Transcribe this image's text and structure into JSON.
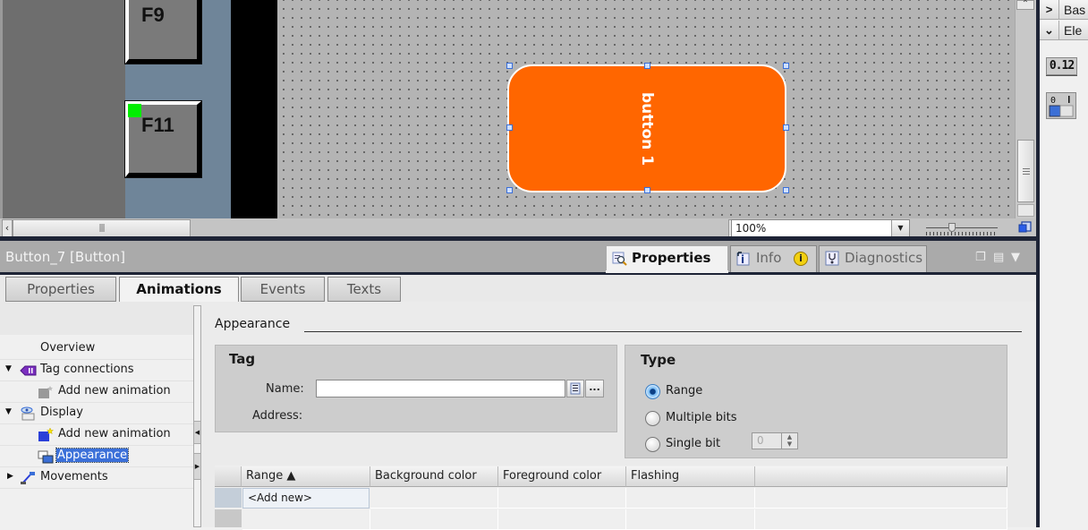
{
  "editor": {
    "function_keys": [
      "F9",
      "F11"
    ],
    "selected_object_label": "button 1",
    "zoom_level": "100%",
    "colors": {
      "button_fill": "#ff6600",
      "canvas": "#b4b4b4",
      "led": "#00ee00"
    }
  },
  "taskcard": {
    "sections": [
      {
        "label": "Bas",
        "expanded": false
      },
      {
        "label": "Ele",
        "expanded": true
      }
    ],
    "elements": [
      {
        "name": "io-field-icon",
        "glyph": "0.12"
      },
      {
        "name": "switch-icon",
        "glyph": "0 I"
      }
    ]
  },
  "inspector": {
    "title": "Button_7 [Button]",
    "tabs": [
      {
        "label": "Properties",
        "active": true
      },
      {
        "label": "Info",
        "active": false
      },
      {
        "label": "Diagnostics",
        "active": false
      }
    ],
    "subtabs": [
      {
        "label": "Properties",
        "active": false
      },
      {
        "label": "Animations",
        "active": true
      },
      {
        "label": "Events",
        "active": false
      },
      {
        "label": "Texts",
        "active": false
      }
    ]
  },
  "tree": {
    "items": [
      {
        "label": "Overview",
        "level": 1,
        "expander": ""
      },
      {
        "label": "Tag connections",
        "level": 0,
        "expander": "▼"
      },
      {
        "label": "Add new animation",
        "level": 1,
        "expander": ""
      },
      {
        "label": "Display",
        "level": 0,
        "expander": "▼"
      },
      {
        "label": "Add new animation",
        "level": 1,
        "expander": ""
      },
      {
        "label": "Appearance",
        "level": 1,
        "expander": "",
        "selected": true
      },
      {
        "label": "Movements",
        "level": 0,
        "expander": "▶"
      }
    ]
  },
  "appearance": {
    "section_title": "Appearance",
    "tag": {
      "title": "Tag",
      "name_label": "Name:",
      "name_value": "",
      "address_label": "Address:",
      "browse_label": "..."
    },
    "type": {
      "title": "Type",
      "options": [
        {
          "label": "Range",
          "selected": true
        },
        {
          "label": "Multiple bits",
          "selected": false
        },
        {
          "label": "Single bit",
          "selected": false
        }
      ],
      "single_bit_value": "0"
    },
    "table": {
      "columns": [
        "Range ▲",
        "Background color",
        "Foreground color",
        "Flashing",
        ""
      ],
      "rows": [
        [
          "<Add new>",
          "",
          "",
          "",
          ""
        ],
        [
          "",
          "",
          "",
          "",
          ""
        ]
      ]
    }
  }
}
